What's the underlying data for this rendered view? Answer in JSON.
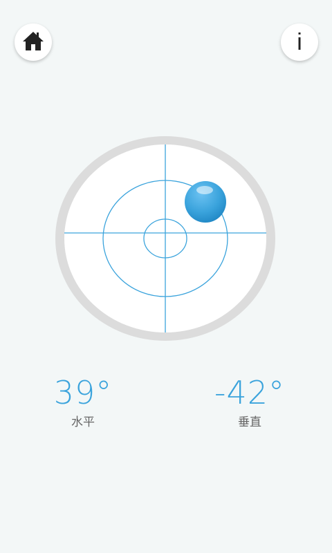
{
  "toolbar": {
    "home_icon": "home-icon",
    "info_icon": "info-icon",
    "info_glyph": "i"
  },
  "level": {
    "bubble_color": "#3aa3dc",
    "crosshair_color": "#3aa3dc"
  },
  "readouts": {
    "horizontal": {
      "value": "39°",
      "label": "水平"
    },
    "vertical": {
      "value": "-42°",
      "label": "垂直"
    }
  },
  "colors": {
    "accent": "#3aa3dc",
    "background": "#f3f7f7",
    "rim": "#dcdcdc"
  }
}
